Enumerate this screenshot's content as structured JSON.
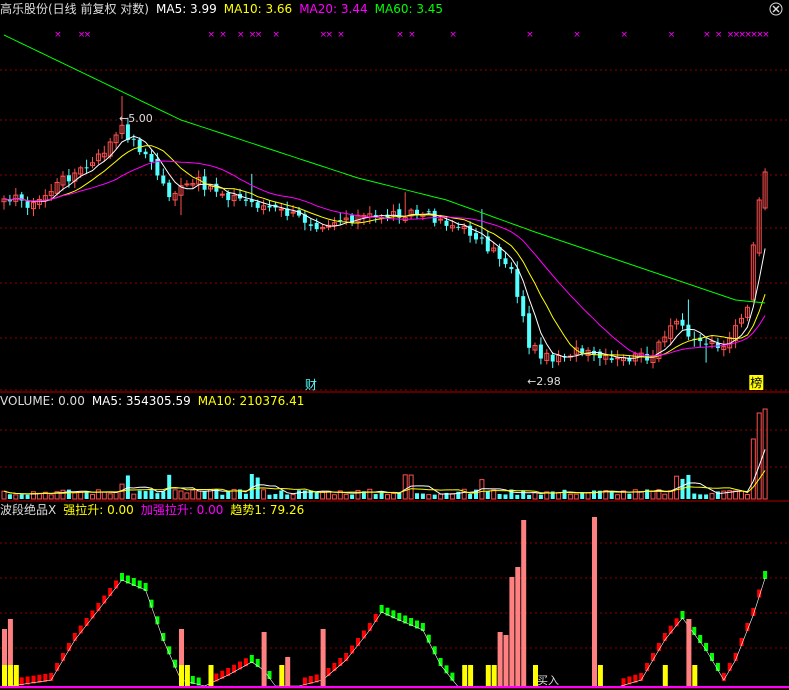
{
  "header": {
    "title": "高乐股份(日线 前复权 对数)",
    "ma5": "MA5: 3.99",
    "ma10": "MA10: 3.66",
    "ma20": "MA20: 3.44",
    "ma60": "MA60: 3.45"
  },
  "volume_header": {
    "title": "VOLUME: 0.00",
    "ma5": "MA5: 354305.59",
    "ma10": "MA10: 210376.41"
  },
  "indicator_header": {
    "title": "波段绝品X",
    "strong": "强拉升: 0.00",
    "enhanced": "加强拉升: 0.00",
    "trend": "趋势1: 79.26"
  },
  "colors": {
    "up": "#ff5050",
    "down": "#54ffff",
    "ma5": "#ffffff",
    "ma10": "#ffff00",
    "ma20": "#ff00ff",
    "ma60": "#00ff00",
    "grid": "#8b0000",
    "trend_up": "#ff0000",
    "trend_down": "#00ff00",
    "bar_pink": "#ff8080",
    "bar_yellow": "#ffff00"
  },
  "chart_data": {
    "type": "candlestick",
    "markers": {
      "high": "5.00",
      "low": "2.98"
    },
    "labels": {
      "cai": "财",
      "bang": "榜",
      "buy": "买入"
    },
    "top_marker_symbol": "×"
  }
}
